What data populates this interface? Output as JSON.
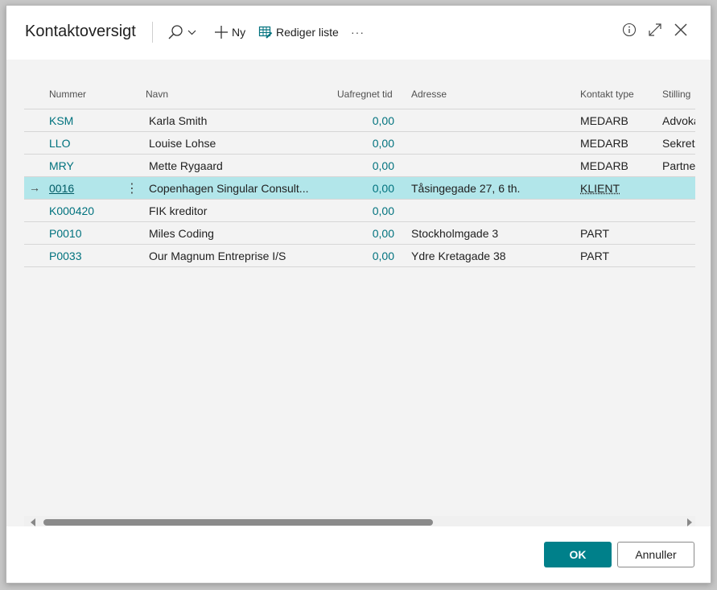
{
  "dialog": {
    "title": "Kontaktoversigt",
    "toolbar": {
      "search_icon": "search-icon",
      "new_label": "Ny",
      "edit_list_label": "Rediger liste",
      "more_label": "···"
    }
  },
  "table": {
    "headers": {
      "number": "Nummer",
      "name": "Navn",
      "balance": "Uafregnet tid",
      "address": "Adresse",
      "type": "Kontakt type",
      "job": "Stilling"
    },
    "rows": [
      {
        "number": "KSM",
        "name": "Karla Smith",
        "balance": "0,00",
        "address": "",
        "type": "MEDARB",
        "job": "Advokat"
      },
      {
        "number": "LLO",
        "name": "Louise Lohse",
        "balance": "0,00",
        "address": "",
        "type": "MEDARB",
        "job": "Sekretær"
      },
      {
        "number": "MRY",
        "name": "Mette Rygaard",
        "balance": "0,00",
        "address": "",
        "type": "MEDARB",
        "job": "Partner"
      },
      {
        "number": "0016",
        "name": "Copenhagen Singular Consult...",
        "balance": "0,00",
        "address": "Tåsingegade 27, 6 th.",
        "type": "KLIENT",
        "job": ""
      },
      {
        "number": "K000420",
        "name": "FIK kreditor",
        "balance": "0,00",
        "address": "",
        "type": "",
        "job": ""
      },
      {
        "number": "P0010",
        "name": "Miles Coding",
        "balance": "0,00",
        "address": "Stockholmgade 3",
        "type": "PART",
        "job": ""
      },
      {
        "number": "P0033",
        "name": "Our Magnum Entreprise I/S",
        "balance": "0,00",
        "address": "Ydre Kretagade 38",
        "type": "PART",
        "job": ""
      }
    ],
    "selected_row_marker": "→",
    "row_menu": "⋮"
  },
  "footer": {
    "ok_label": "OK",
    "cancel_label": "Annuller"
  },
  "colors": {
    "accent": "#00808a",
    "link": "#00727e",
    "selected_row": "#b2e6ea"
  }
}
